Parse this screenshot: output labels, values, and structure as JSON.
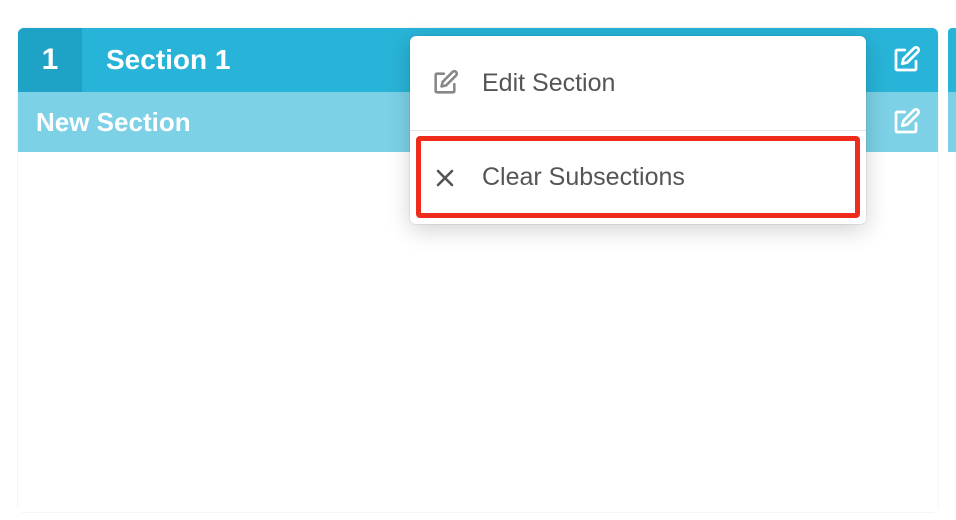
{
  "section": {
    "number": "1",
    "title": "Section 1"
  },
  "subsection": {
    "title": "New Section"
  },
  "dropdown": {
    "items": [
      {
        "label": "Edit Section"
      },
      {
        "label": "Clear Subsections"
      }
    ]
  }
}
